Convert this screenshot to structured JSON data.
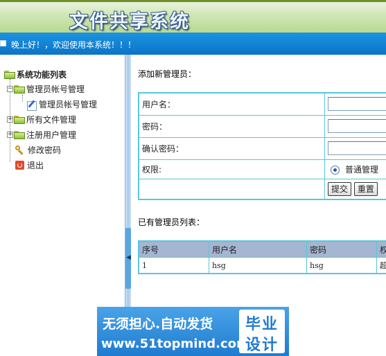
{
  "header": {
    "title": "文件共享系统"
  },
  "welcome": {
    "text": "晚上好！，欢迎使用本系统！！！"
  },
  "sidebar": {
    "root": "系统功能列表",
    "items": [
      {
        "label": "管理员帐号管理",
        "icon": "folder-icon"
      },
      {
        "label": "管理员帐号管理",
        "icon": "edit-icon"
      },
      {
        "label": "所有文件管理",
        "icon": "folder-icon"
      },
      {
        "label": "注册用户管理",
        "icon": "folder-icon"
      },
      {
        "label": "修改密码",
        "icon": "key-icon"
      },
      {
        "label": "退出",
        "icon": "exit-icon"
      }
    ]
  },
  "form": {
    "heading": "添加新管理员：",
    "username_label": "用户名：",
    "password_label": "密码：",
    "confirm_label": "确认密码：",
    "permission_label": "权限:",
    "permission_option": "普通管理",
    "submit_label": "提交",
    "reset_label": "重置"
  },
  "list": {
    "heading": "已有管理员列表：",
    "columns": [
      "序号",
      "用户名",
      "密码",
      "权"
    ],
    "rows": [
      [
        "1",
        "hsg",
        "hsg",
        "超"
      ]
    ]
  },
  "watermark": {
    "line1": "无须担心.自动发货",
    "line2": "www.51topmind.com",
    "badge_top": "毕业",
    "badge_bottom": "设计"
  },
  "colors": {
    "accent": "#0c74c8",
    "border": "#57c7d8",
    "header_bg": "#cfe6b3"
  }
}
